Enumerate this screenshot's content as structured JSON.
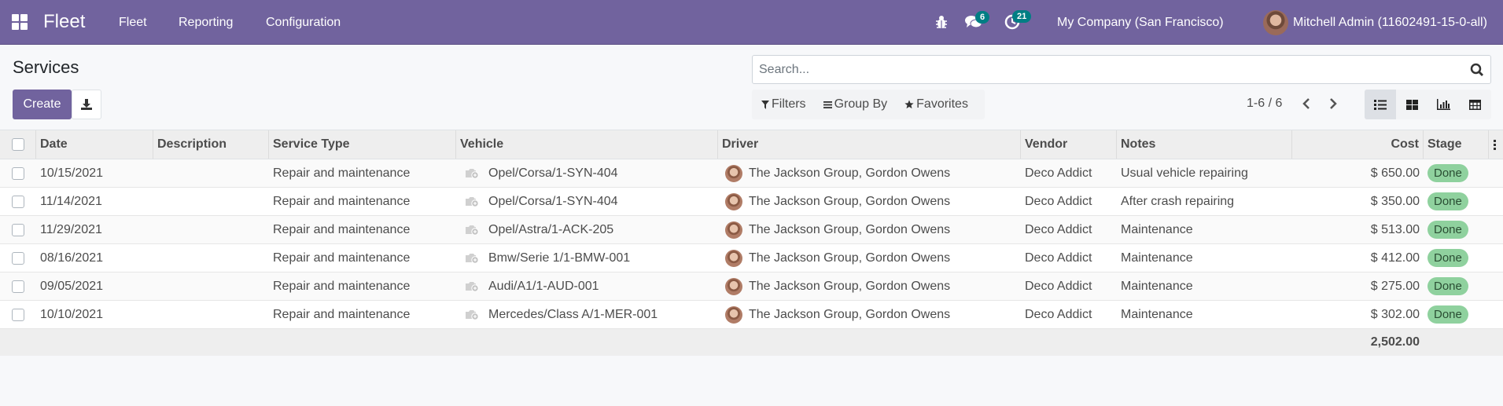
{
  "navbar": {
    "brand": "Fleet",
    "menus": [
      "Fleet",
      "Reporting",
      "Configuration"
    ],
    "messages_count": "6",
    "activities_count": "21",
    "company": "My Company (San Francisco)",
    "user": "Mitchell Admin (11602491-15-0-all)",
    "icons": [
      "apps-icon",
      "bug-icon",
      "chat-icon",
      "clock-icon"
    ]
  },
  "control_panel": {
    "title": "Services",
    "create_label": "Create",
    "search_placeholder": "Search...",
    "search_value": "",
    "filters_label": "Filters",
    "group_by_label": "Group By",
    "favorites_label": "Favorites",
    "pager": "1-6 / 6",
    "views": [
      "list",
      "kanban",
      "graph",
      "pivot"
    ],
    "active_view": "list"
  },
  "table": {
    "columns": [
      "Date",
      "Description",
      "Service Type",
      "Vehicle",
      "Driver",
      "Vendor",
      "Notes",
      "Cost",
      "Stage"
    ],
    "rows": [
      {
        "date": "10/15/2021",
        "description": "",
        "service_type": "Repair and maintenance",
        "vehicle": "Opel/Corsa/1-SYN-404",
        "driver": "The Jackson Group, Gordon Owens",
        "vendor": "Deco Addict",
        "notes": "Usual vehicle repairing",
        "cost": "$ 650.00",
        "stage": "Done"
      },
      {
        "date": "11/14/2021",
        "description": "",
        "service_type": "Repair and maintenance",
        "vehicle": "Opel/Corsa/1-SYN-404",
        "driver": "The Jackson Group, Gordon Owens",
        "vendor": "Deco Addict",
        "notes": "After crash repairing",
        "cost": "$ 350.00",
        "stage": "Done"
      },
      {
        "date": "11/29/2021",
        "description": "",
        "service_type": "Repair and maintenance",
        "vehicle": "Opel/Astra/1-ACK-205",
        "driver": "The Jackson Group, Gordon Owens",
        "vendor": "Deco Addict",
        "notes": "Maintenance",
        "cost": "$ 513.00",
        "stage": "Done"
      },
      {
        "date": "08/16/2021",
        "description": "",
        "service_type": "Repair and maintenance",
        "vehicle": "Bmw/Serie 1/1-BMW-001",
        "driver": "The Jackson Group, Gordon Owens",
        "vendor": "Deco Addict",
        "notes": "Maintenance",
        "cost": "$ 412.00",
        "stage": "Done"
      },
      {
        "date": "09/05/2021",
        "description": "",
        "service_type": "Repair and maintenance",
        "vehicle": "Audi/A1/1-AUD-001",
        "driver": "The Jackson Group, Gordon Owens",
        "vendor": "Deco Addict",
        "notes": "Maintenance",
        "cost": "$ 275.00",
        "stage": "Done"
      },
      {
        "date": "10/10/2021",
        "description": "",
        "service_type": "Repair and maintenance",
        "vehicle": "Mercedes/Class A/1-MER-001",
        "driver": "The Jackson Group, Gordon Owens",
        "vendor": "Deco Addict",
        "notes": "Maintenance",
        "cost": "$ 302.00",
        "stage": "Done"
      }
    ],
    "total_cost": "2,502.00"
  },
  "colors": {
    "brand": "#71639e",
    "badge": "#017e84",
    "stage_done": "#8fd19e"
  }
}
